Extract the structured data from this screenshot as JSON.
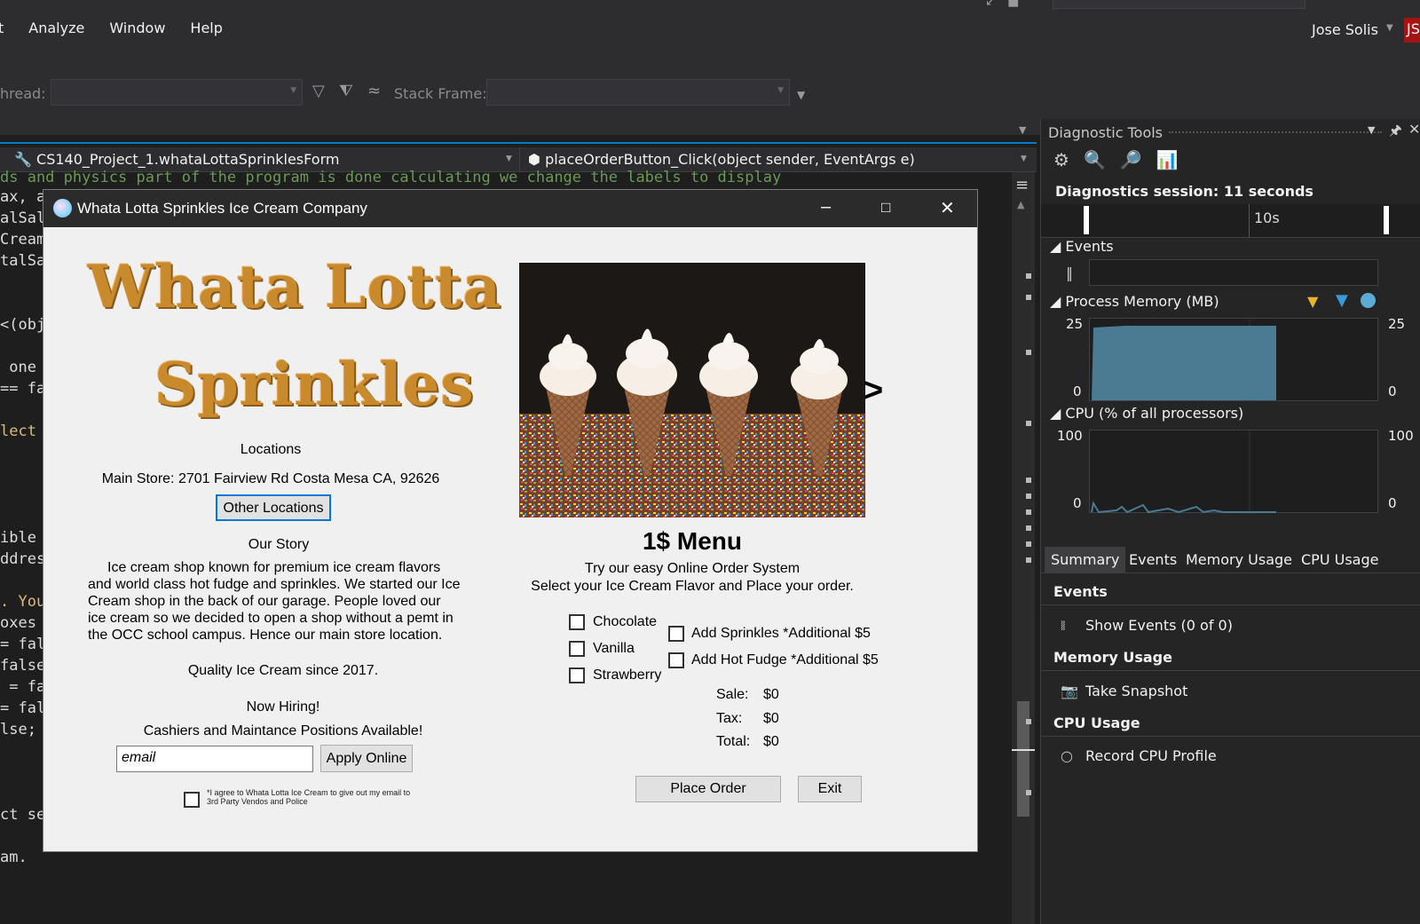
{
  "menu": {
    "items": [
      "t",
      "Analyze",
      "Window",
      "Help"
    ]
  },
  "account": {
    "user": "Jose Solis",
    "initials": "JS"
  },
  "toolbar": {
    "thread_label": "hread:",
    "stack_label": "Stack Frame:"
  },
  "editor": {
    "nav_class": "CS140_Project_1.whataLottaSprinklesForm",
    "nav_method": "placeOrderButton_Click(object sender, EventArgs e)",
    "code_lines": [
      "ds and physics part of the program is done calculating we change the labels to display",
      "ax, a",
      "alSal",
      "Cream",
      "talSa",
      "<(obj",
      " one",
      "== fa",
      "lect",
      "ible",
      "ddres",
      ". You",
      "oxes",
      "= fal",
      "false",
      " = fa",
      "= fal",
      "lse;",
      "ct se",
      "am."
    ]
  },
  "app": {
    "title": "Whata Lotta Sprinkles Ice Cream Company",
    "logo_line1": "Whata Lotta",
    "logo_line2": "Sprinkles",
    "locations_heading": "Locations",
    "main_store": "Main Store: 2701 Fairview Rd Costa Mesa CA, 92626",
    "other_locations": "Other Locations",
    "story_heading": "Our Story",
    "story_text": "Ice cream shop known for premium ice cream flavors and world class hot fudge and sprinkles. We started our Ice Cream shop in the back of our garage. People loved our ice cream so we decided to open a shop without a pemt in the OCC school campus. Hence our main store location.",
    "quality": "Quality Ice Cream since 2017.",
    "hiring": "Now Hiring!",
    "positions": "Cashiers and Maintance Positions Available!",
    "email_placeholder": "email",
    "apply_online": "Apply Online",
    "agree_text": "*I agree to Whata Lotta Ice Cream to give out my email to 3rd Party Vendos and Police",
    "next_arrow": ">",
    "menu_heading": "1$ Menu",
    "menu_sub1": "Try our easy Online Order System",
    "menu_sub2": "Select your Ice Cream Flavor and Place your order.",
    "flavors": [
      "Chocolate",
      "Vanilla",
      "Strawberry"
    ],
    "addons": [
      "Add Sprinkles *Additional $5",
      "Add Hot Fudge *Additional $5"
    ],
    "sale_label": "Sale:",
    "sale_value": "$0",
    "tax_label": "Tax:",
    "tax_value": "$0",
    "total_label": "Total:",
    "total_value": "$0",
    "place_order": "Place Order",
    "exit": "Exit"
  },
  "diagnostics": {
    "title": "Diagnostic Tools",
    "session": "Diagnostics session: 11 seconds",
    "timeline_tick": "10s",
    "events_label": "Events",
    "memory_label": "Process Memory (MB)",
    "memory_max": "25",
    "memory_min": "0",
    "cpu_label": "CPU (% of all processors)",
    "cpu_max": "100",
    "cpu_min": "0",
    "tabs": [
      "Summary",
      "Events",
      "Memory Usage",
      "CPU Usage"
    ],
    "events_heading": "Events",
    "show_events": "Show Events (0 of 0)",
    "memory_heading": "Memory Usage",
    "take_snapshot": "Take Snapshot",
    "cpu_heading": "CPU Usage",
    "record_cpu": "Record CPU Profile",
    "colors": {
      "memory_fill": "#4a7b92",
      "accent": "#007acc"
    }
  }
}
